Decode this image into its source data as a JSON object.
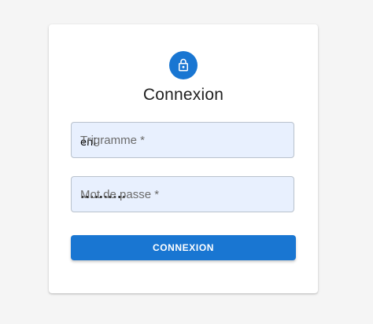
{
  "login": {
    "title": "Connexion",
    "icon": "lock-icon",
    "accent_color": "#1976d2",
    "fields": {
      "trigramme": {
        "label": "Trigramme *",
        "value": "eni"
      },
      "password": {
        "label": "Mot de passe *",
        "value": "••••••••••"
      }
    },
    "submit_label": "CONNEXION"
  }
}
